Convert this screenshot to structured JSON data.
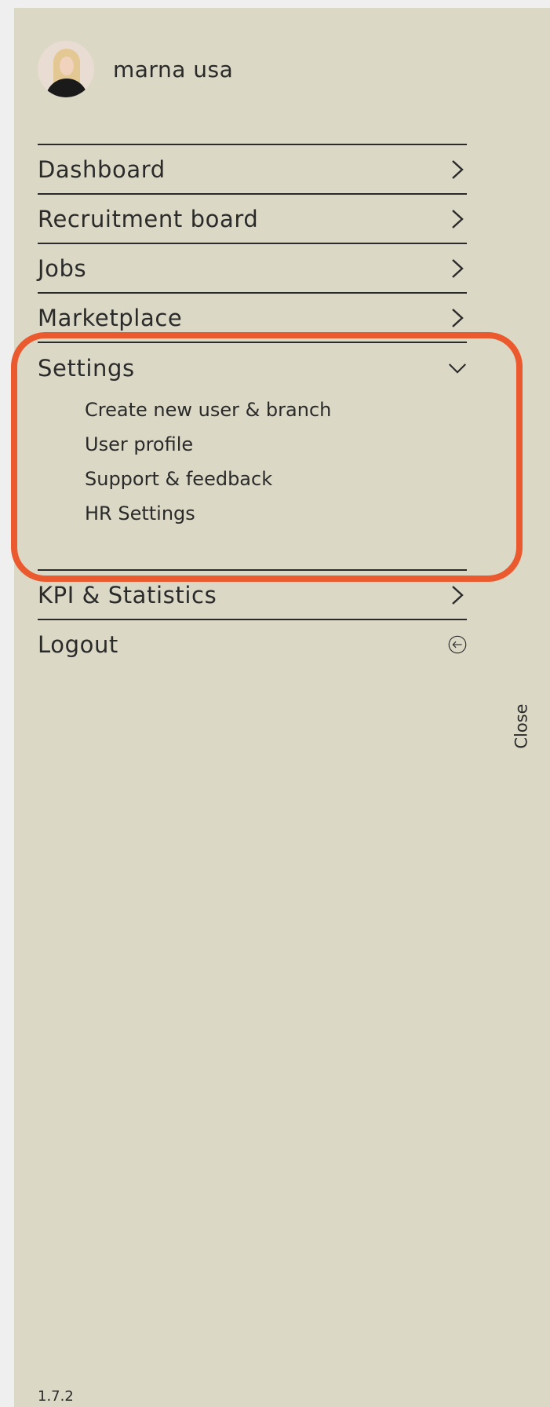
{
  "user": {
    "name": "marna usa"
  },
  "menu": {
    "items": [
      {
        "label": "Dashboard",
        "icon": "chevron-right-icon"
      },
      {
        "label": "Recruitment board",
        "icon": "chevron-right-icon"
      },
      {
        "label": "Jobs",
        "icon": "chevron-right-icon"
      },
      {
        "label": "Marketplace",
        "icon": "chevron-right-icon"
      }
    ],
    "settings": {
      "label": "Settings",
      "icon": "chevron-down-icon",
      "expanded": true,
      "subitems": [
        {
          "label": "Create new user & branch"
        },
        {
          "label": "User profile"
        },
        {
          "label": "Support & feedback"
        },
        {
          "label": "HR Settings"
        }
      ]
    },
    "after": [
      {
        "label": "KPI & Statistics",
        "icon": "chevron-right-icon"
      },
      {
        "label": "Logout",
        "icon": "logout-circle-arrow-icon"
      }
    ]
  },
  "close_tab": {
    "label": "Close"
  },
  "version": "1.7.2",
  "colors": {
    "drawer_bg": "#dbd8c6",
    "page_bg": "#efefef",
    "text": "#2a2a2a",
    "highlight": "#ea5a2e"
  }
}
